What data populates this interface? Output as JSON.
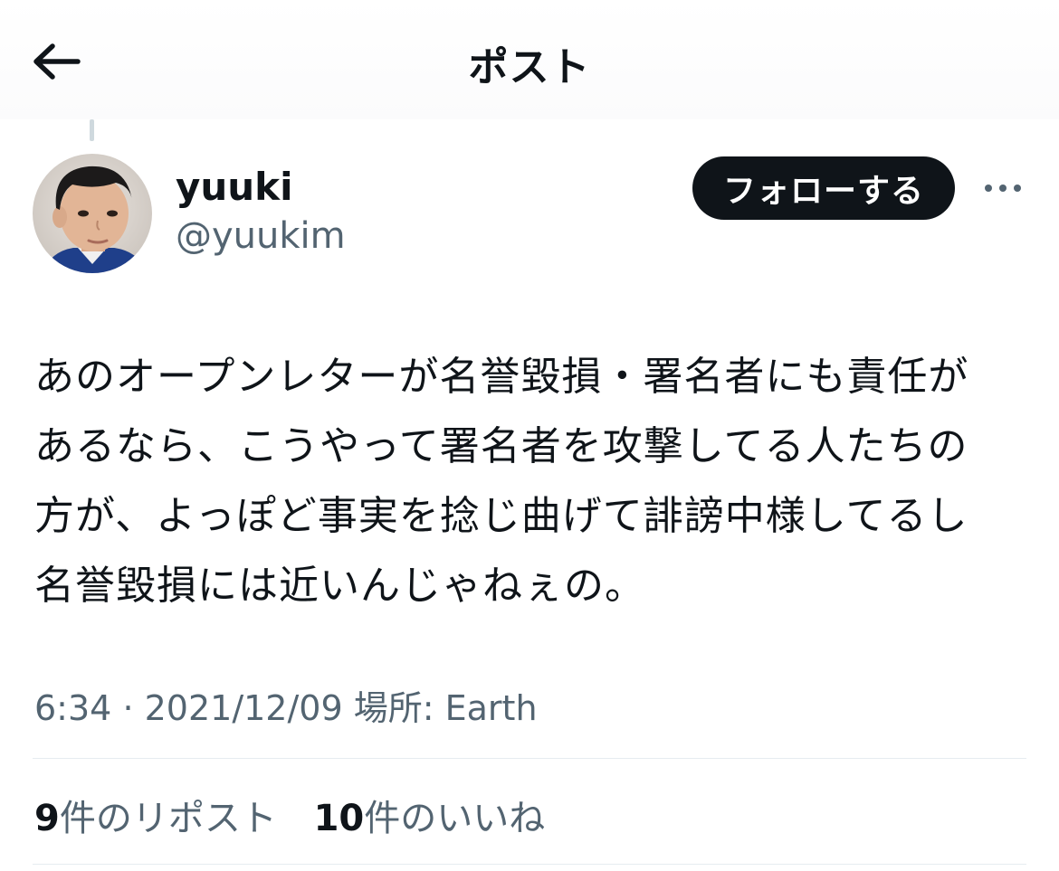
{
  "header": {
    "title": "ポスト",
    "back_icon": "back-arrow-icon"
  },
  "author": {
    "display_name": "yuuki",
    "handle": "@yuukim",
    "follow_label": "フォローする",
    "more_icon": "more-horizontal-icon"
  },
  "post": {
    "lines": [
      "あのオープンレターが名誉毀損・署名者にも責任が",
      "あるなら、こうやって署名者を攻撃してる人たちの",
      "方が、よっぽど事実を捻じ曲げて誹謗中様してるし",
      "名誉毀損には近いんじゃねぇの。"
    ]
  },
  "meta": {
    "time": "6:34",
    "separator": "·",
    "date": "2021/12/09",
    "location_label": "場所: Earth"
  },
  "stats": {
    "reposts_count": "9",
    "reposts_label": "件のリポスト",
    "likes_count": "10",
    "likes_label": "件のいいね"
  },
  "colors": {
    "text_primary": "#0f1419",
    "text_secondary": "#536471",
    "divider": "#e6ecf0",
    "follow_bg": "#0f1419"
  }
}
